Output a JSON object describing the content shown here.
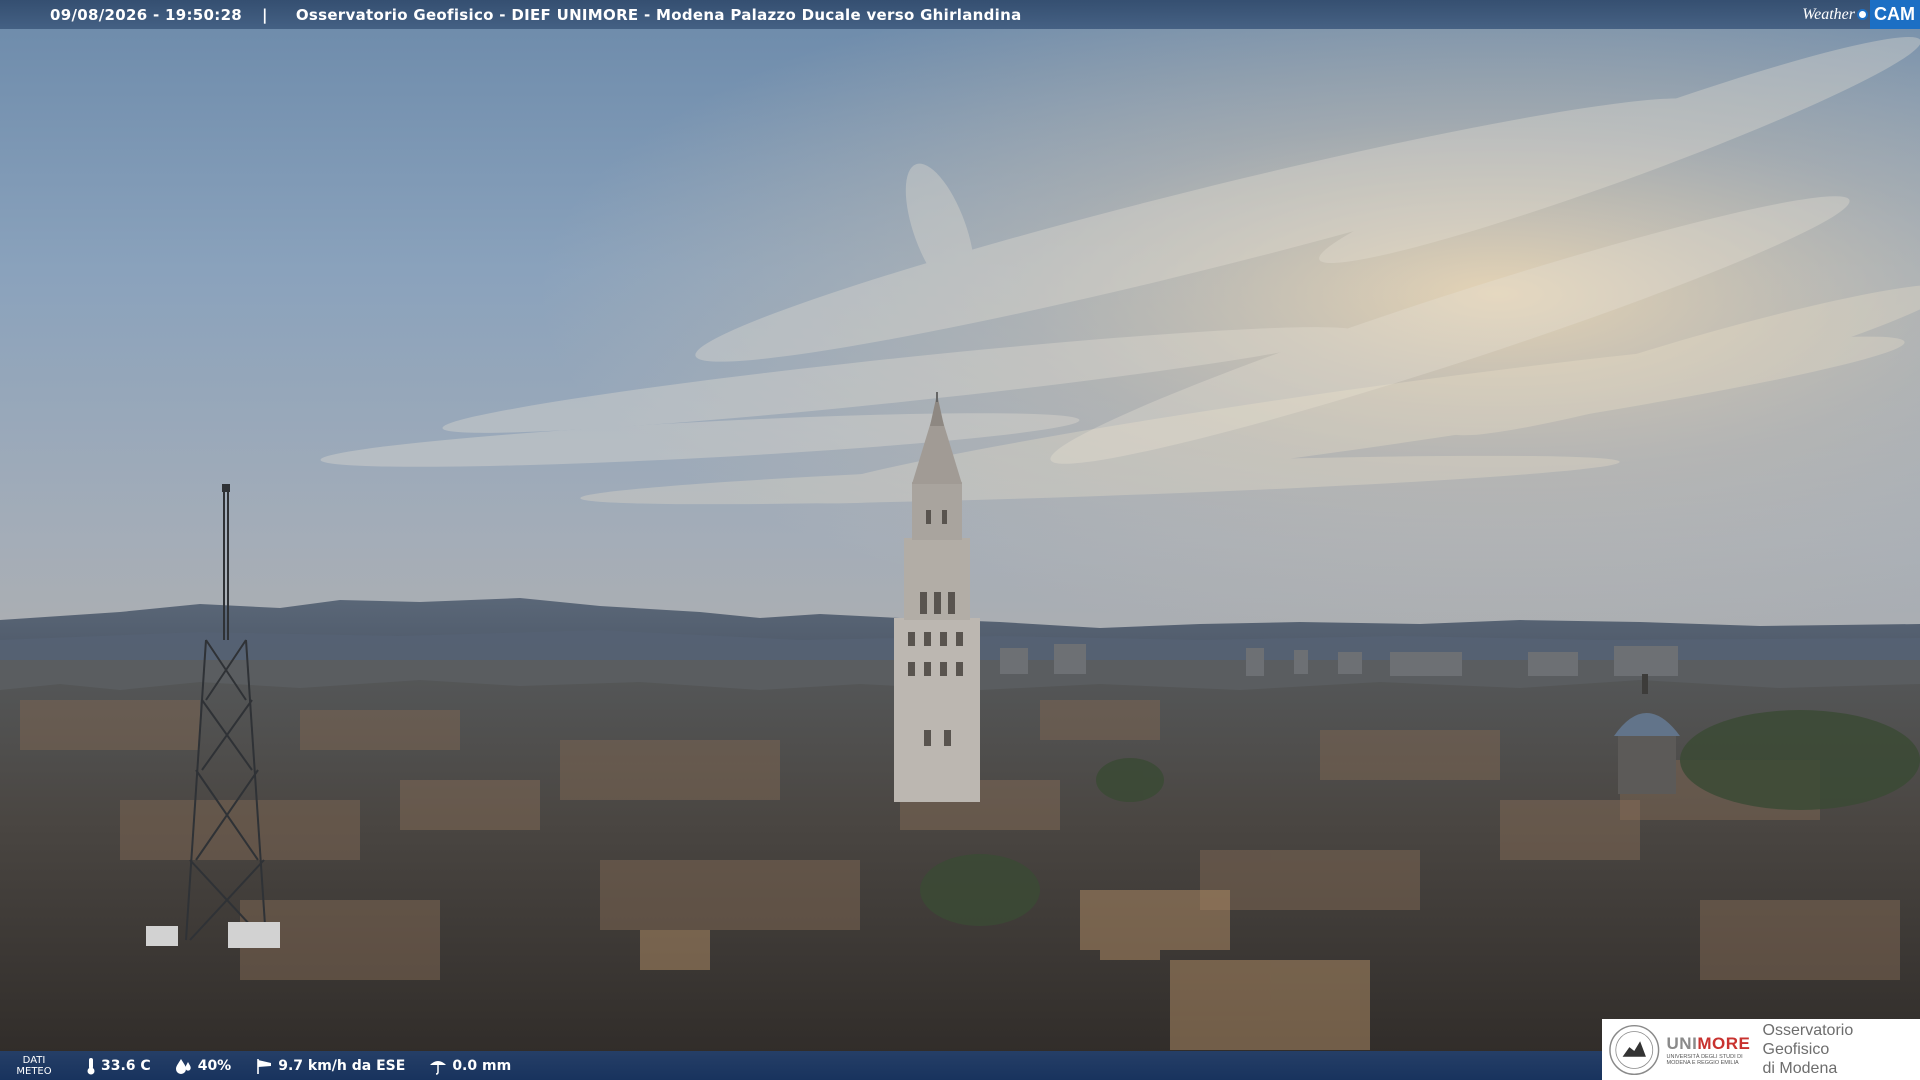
{
  "header": {
    "datetime": "09/08/2026 - 19:50:28",
    "separator": "|",
    "title": "Osservatorio Geofisico - DIEF UNIMORE - Modena Palazzo Ducale verso Ghirlandina"
  },
  "brand": {
    "weather": "Weather",
    "cam": "CAM"
  },
  "meteo": {
    "label_line1": "DATI",
    "label_line2": "METEO",
    "temperature": "33.6 C",
    "humidity": "40%",
    "wind": "9.7 km/h da ESE",
    "rain": "0.0 mm",
    "icons": [
      "thermometer-icon",
      "humidity-drops-icon",
      "wind-sock-icon",
      "rain-gauge-icon"
    ]
  },
  "logo": {
    "unimore_a": "UNI",
    "unimore_b": "MORE",
    "unimore_sub": "UNIVERSITÀ DEGLI STUDI DI MODENA E REGGIO EMILIA",
    "obs_line1": "Osservatorio Geofisico",
    "obs_line2": "di Modena"
  },
  "colors": {
    "bar_blue": "#304a6c",
    "cam_blue": "#1c6fc4",
    "unimore_red": "#c8322f"
  }
}
